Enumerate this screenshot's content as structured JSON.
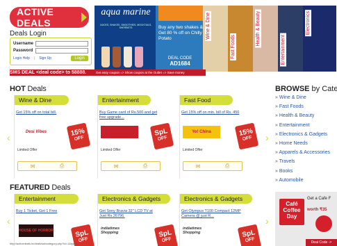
{
  "brand": {
    "name": "ACTIVE DEALS"
  },
  "login": {
    "title": "Deals Login",
    "username_label": "Username",
    "password_label": "Password",
    "username_value": "",
    "password_value": "",
    "help_link": "Login Help",
    "signup_link": "Sign Up",
    "login_button": "Login"
  },
  "banner": {
    "brand": "aqua marine",
    "tagline": "JUICES, SHAKES, SMOOTHIES, MOCKTAILS, SHERBETS",
    "promo": "Buy any two shakes & Get 80 % off on Chilly Potato",
    "code_label": "DEAL CODE",
    "code": "AD1684",
    "categories": [
      "Wine & Dine",
      "Fast Foods",
      "Health & Beauty",
      "Entertainment",
      "Electronics"
    ]
  },
  "ticker": {
    "sms": "SMS DEAL <deal code> to 58888.",
    "text": "Get easy coupon => Show coupon at the Outlet => Save money"
  },
  "hot": {
    "title_bold": "HOT",
    "title_rest": " Deals",
    "cards": [
      {
        "category": "Wine & Dine",
        "offer": "Get 15% off on total bill.",
        "merchant": "Desi Vibes",
        "discount": "15%",
        "discount_unit": "OFF",
        "limited": "Limited Offer"
      },
      {
        "category": "Entertainment",
        "offer": "Buy Game card of Rs.500 and get free upgrade...",
        "merchant": "",
        "discount": "SpL",
        "discount_unit": "OFF",
        "limited": "Limited Offer"
      },
      {
        "category": "Fast Food",
        "offer": "Get 15% off on min. bill of Rs. 450",
        "merchant": "Yo! China",
        "discount": "15%",
        "discount_unit": "OFF",
        "limited": "Limited Offer"
      }
    ]
  },
  "featured": {
    "title_bold": "FEATURED",
    "title_rest": " Deals",
    "cards": [
      {
        "category": "Entertainment",
        "offer": "Buy 1 Ticket, Get 1 Free",
        "merchant": "HOUSE OF HORROR",
        "discount": "SpL",
        "discount_unit": "OFF"
      },
      {
        "category": "Electronics & Gadgets",
        "offer": "Get Sony Bravia 32\" LCD TV at Just Rs.26796.",
        "merchant": "indiatimes Shopping",
        "discount": "SpL",
        "discount_unit": "OFF"
      },
      {
        "category": "Electronics & Gadgets",
        "offer": "Get Olympus T100 Compact 12MP Camera @ just R...",
        "merchant": "indiatimes Shopping",
        "discount": "SpL",
        "discount_unit": "OFF"
      }
    ]
  },
  "browse": {
    "title_bold": "BROWSE",
    "title_rest": " by Category",
    "items": [
      "Wine & Dine",
      "Fast Foods",
      "Health & Beauty",
      "Entertainment",
      "Electronics & Gadgets",
      "Home Needs",
      "Apparels & Accessories",
      "Travels",
      "Books",
      "Automobile"
    ]
  },
  "cafe": {
    "logo": "Café Coffee Day",
    "text": "Get a Cafe F",
    "price": "worth ₹35",
    "code": "Deal Code ->"
  },
  "footer": {
    "status": "http://activedeals.in/deals/subcategory.php?id=1&type=..."
  },
  "colors": {
    "accent": "#d4de3a",
    "brand_red": "#e0303e",
    "link": "#2b57a5"
  }
}
